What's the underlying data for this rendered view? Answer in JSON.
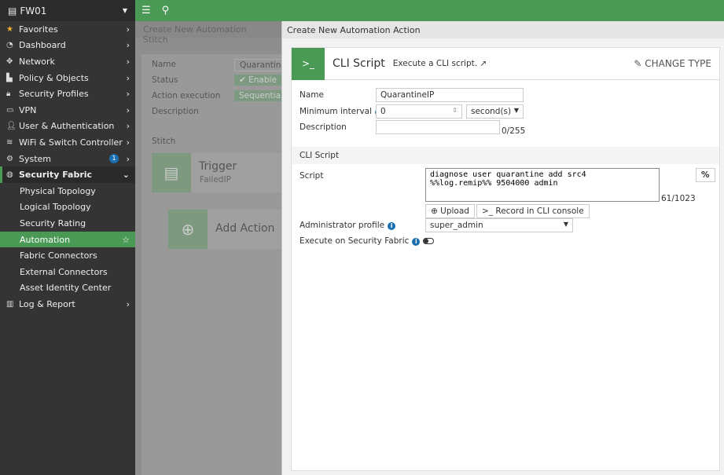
{
  "sidebar": {
    "device": "FW01",
    "items": [
      {
        "label": "Favorites",
        "icon": "star-icon"
      },
      {
        "label": "Dashboard",
        "icon": "dashboard-icon"
      },
      {
        "label": "Network",
        "icon": "network-icon"
      },
      {
        "label": "Policy & Objects",
        "icon": "policy-icon"
      },
      {
        "label": "Security Profiles",
        "icon": "lock-icon"
      },
      {
        "label": "VPN",
        "icon": "laptop-icon"
      },
      {
        "label": "User & Authentication",
        "icon": "user-icon"
      },
      {
        "label": "WiFi & Switch Controller",
        "icon": "wifi-icon"
      },
      {
        "label": "System",
        "icon": "gear-icon",
        "badge": "1"
      },
      {
        "label": "Security Fabric",
        "icon": "fabric-icon"
      }
    ],
    "sub": [
      "Physical Topology",
      "Logical Topology",
      "Security Rating",
      "Automation",
      "Fabric Connectors",
      "External Connectors",
      "Asset Identity Center"
    ],
    "last": "Log & Report"
  },
  "background": {
    "title": "Create New Automation Stitch",
    "name_label": "Name",
    "name_value": "QuarantineS",
    "status_label": "Status",
    "status_value": "Enable",
    "exec_label": "Action execution",
    "exec_value": "Sequential",
    "desc_label": "Description",
    "stitch_label": "Stitch",
    "trigger": "Trigger",
    "trigger_sub": "FailedIP",
    "add_action": "Add Action"
  },
  "panel": {
    "title": "Create New Automation Action",
    "type_title": "CLI Script",
    "type_desc": "Execute a CLI script.",
    "change_type": "CHANGE TYPE",
    "name_label": "Name",
    "name_value": "QuarantineIP",
    "interval_label": "Minimum interval",
    "interval_value": "0",
    "interval_unit": "second(s)",
    "desc_label": "Description",
    "desc_count": "0/255",
    "section": "CLI Script",
    "script_label": "Script",
    "script_value": "diagnose user quarantine add src4\n%%log.remip%% 9504000 admin",
    "script_count": "61/1023",
    "percent": "%",
    "upload": "Upload",
    "record": "Record in CLI console",
    "admin_label": "Administrator profile",
    "admin_value": "super_admin",
    "fabric_label": "Execute on Security Fabric"
  }
}
